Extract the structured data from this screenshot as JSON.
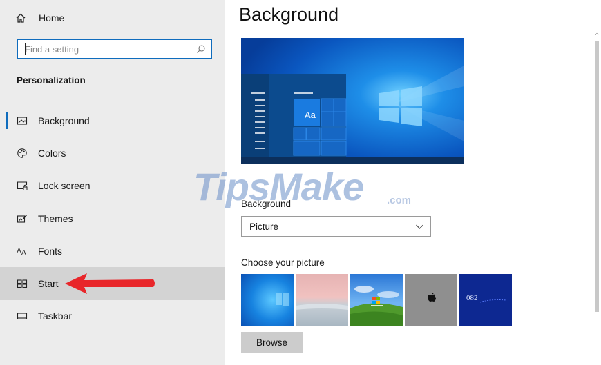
{
  "sidebar": {
    "home_label": "Home",
    "search": {
      "placeholder": "Find a setting"
    },
    "section_title": "Personalization",
    "items": [
      {
        "label": "Background",
        "icon": "picture-icon"
      },
      {
        "label": "Colors",
        "icon": "palette-icon"
      },
      {
        "label": "Lock screen",
        "icon": "lock-screen-icon"
      },
      {
        "label": "Themes",
        "icon": "themes-icon"
      },
      {
        "label": "Fonts",
        "icon": "fonts-icon"
      },
      {
        "label": "Start",
        "icon": "start-icon"
      },
      {
        "label": "Taskbar",
        "icon": "taskbar-icon"
      }
    ],
    "active_item": "Background",
    "hovered_item": "Start"
  },
  "main": {
    "title": "Background",
    "preview": {
      "tile_label": "Aa"
    },
    "background_label": "Background",
    "background_dropdown": {
      "selected": "Picture"
    },
    "choose_label": "Choose your picture",
    "thumbnails": [
      {
        "name": "windows-blue"
      },
      {
        "name": "pink-sky"
      },
      {
        "name": "bliss-hill"
      },
      {
        "name": "gray-apple"
      },
      {
        "name": "blue-text",
        "text": "082"
      }
    ],
    "browse_label": "Browse"
  },
  "watermark": {
    "brand": "TipsMake",
    "suffix": ".com"
  },
  "colors": {
    "accent": "#0f6cbd",
    "sidebar_bg": "#ececec",
    "hover_bg": "#d3d3d3",
    "arrow": "#e8262a",
    "button_bg": "#cccccc"
  }
}
